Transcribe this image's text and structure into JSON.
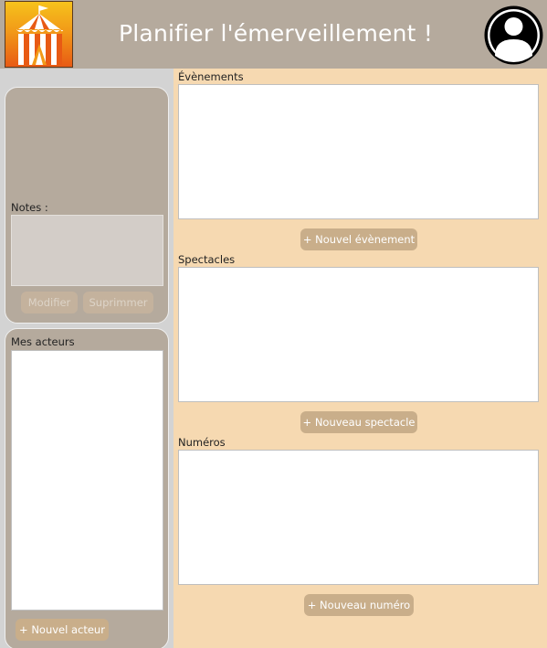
{
  "header": {
    "title": "Planifier l'émerveillement !",
    "logo_icon": "circus-tent-icon",
    "avatar_icon": "user-avatar-icon"
  },
  "notes_panel": {
    "label": "Notes :",
    "modify_label": "Modifier",
    "delete_label": "Suprimmer"
  },
  "actors_panel": {
    "label": "Mes acteurs",
    "new_actor_label": "+ Nouvel acteur"
  },
  "events": {
    "label": "Évènements",
    "new_label": "+ Nouvel évènement"
  },
  "shows": {
    "label": "Spectacles",
    "new_label": "+ Nouveau spectacle"
  },
  "numbers": {
    "label": "Numéros",
    "new_label": "+ Nouveau numéro"
  },
  "colors": {
    "header_bg": "#b5aa9d",
    "right_panel_bg": "#f6d9b1",
    "button_bg": "#c9ae8a"
  }
}
